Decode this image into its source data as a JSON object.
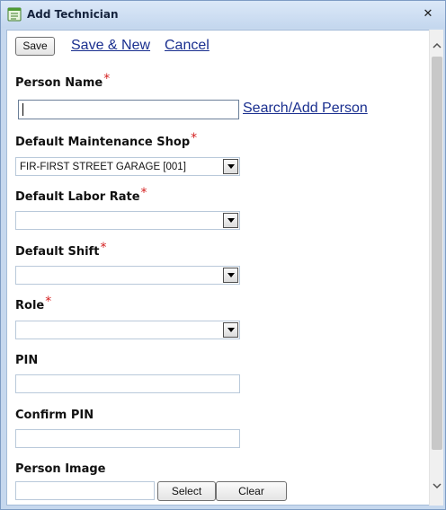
{
  "window": {
    "title": "Add Technician"
  },
  "toolbar": {
    "save_label": "Save",
    "save_new_label": "Save & New",
    "cancel_label": "Cancel"
  },
  "form": {
    "person_name": {
      "label": "Person Name",
      "value": "",
      "search_label": "Search/Add Person"
    },
    "maintenance_shop": {
      "label": "Default Maintenance Shop",
      "value": "FIR-FIRST STREET GARAGE [001]"
    },
    "labor_rate": {
      "label": "Default Labor Rate",
      "value": ""
    },
    "shift": {
      "label": "Default Shift",
      "value": ""
    },
    "role": {
      "label": "Role",
      "value": ""
    },
    "pin": {
      "label": "PIN",
      "value": ""
    },
    "confirm_pin": {
      "label": "Confirm PIN",
      "value": ""
    },
    "person_image": {
      "label": "Person Image",
      "value": "",
      "select_label": "Select",
      "clear_label": "Clear"
    },
    "required_marker": "*"
  },
  "colors": {
    "link": "#1a2f8f",
    "required": "#d42020",
    "frame": "#c6d8ee"
  },
  "icons": {
    "title": "form-icon",
    "close": "close-icon"
  }
}
